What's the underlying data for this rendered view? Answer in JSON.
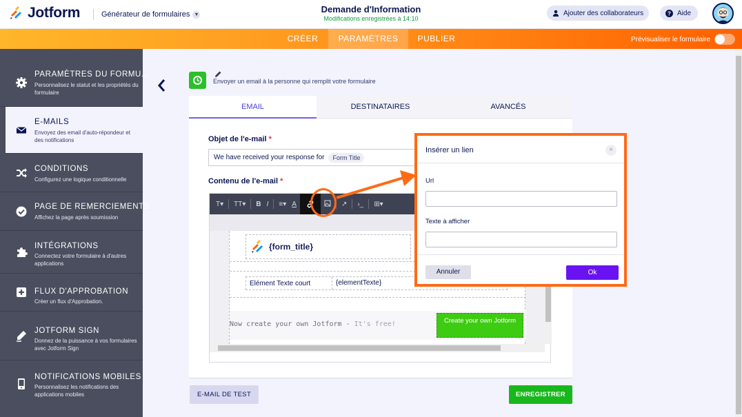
{
  "header": {
    "brand": "Jotform",
    "builder_label": "Générateur de formulaires",
    "doc_title": "Demande d'Information",
    "save_status": "Modifications enregistrées à 14:10",
    "collab_label": "Ajouter des collaborateurs",
    "help_label": "Aide"
  },
  "nav": {
    "tabs": [
      "CRÉER",
      "PARAMÈTRES",
      "PUBLIER"
    ],
    "active": "PARAMÈTRES",
    "preview_label": "Prévisualiser le formulaire"
  },
  "sidebar": {
    "items": [
      {
        "title": "PARAMÈTRES DU FORMU...",
        "desc": "Personnalisez le statut et les propriétés du formulaire",
        "icon": "gear-icon"
      },
      {
        "title": "E-MAILS",
        "desc": "Envoyez des email d'auto-répondeur et des notifications",
        "icon": "envelope-icon"
      },
      {
        "title": "CONDITIONS",
        "desc": "Configurez une logique conditionnelle",
        "icon": "shuffle-icon"
      },
      {
        "title": "PAGE DE REMERCIEMENTS",
        "desc": "Affichez la page après soumission",
        "icon": "check-circle-icon"
      },
      {
        "title": "INTÉGRATIONS",
        "desc": "Connectez votre formulaire à d'autres applications",
        "icon": "puzzle-icon"
      },
      {
        "title": "FLUX D'APPROBATION",
        "desc": "Créer un flux d'Approbation.",
        "icon": "approval-icon"
      },
      {
        "title": "JOTFORM SIGN",
        "desc": "Donnez de la puissance à vos formulaires avec Jotform Sign",
        "icon": "pen-sign-icon"
      },
      {
        "title": "NOTIFICATIONS MOBILES",
        "desc": "Personnalisez les notifications des applications mobiles",
        "icon": "mobile-notification-icon"
      }
    ],
    "active_index": 1
  },
  "task": {
    "description": "Envoyer un email à la personne qui remplit votre formulaire"
  },
  "tabs": [
    "EMAIL",
    "DESTINATAIRES",
    "AVANCÉS"
  ],
  "form": {
    "subject_label": "Objet de l'e-mail",
    "required_mark": "*",
    "subject_value": "We have received your response for",
    "subject_chip": "Form Title",
    "content_label": "Contenu de l'e-mail"
  },
  "toolbar": {
    "items": [
      "T▾",
      "TT▾",
      "B",
      "I",
      "≡▾",
      "A",
      "↗",
      "›_",
      "⊞▾"
    ]
  },
  "email_preview": {
    "form_title": "{form_title}",
    "field_name": "Elément Texte court",
    "field_value": "{elementTexte}",
    "promo_text": "Now create your own Jotform - ",
    "promo_free": "It's free!",
    "promo_button": "Create your own Jotform"
  },
  "footer": {
    "test_label": "E-MAIL DE TEST",
    "save_label": "ENREGISTRER"
  },
  "modal": {
    "title": "Insérer un lien",
    "close": "×",
    "url_label": "Url",
    "text_label": "Texte à afficher",
    "cancel_label": "Annuler",
    "ok_label": "Ok"
  },
  "colors": {
    "accent_orange": "#ff6a16",
    "primary_purple": "#6a13f2",
    "save_green": "#18b81c",
    "sidebar_bg": "#4a4e5e"
  }
}
